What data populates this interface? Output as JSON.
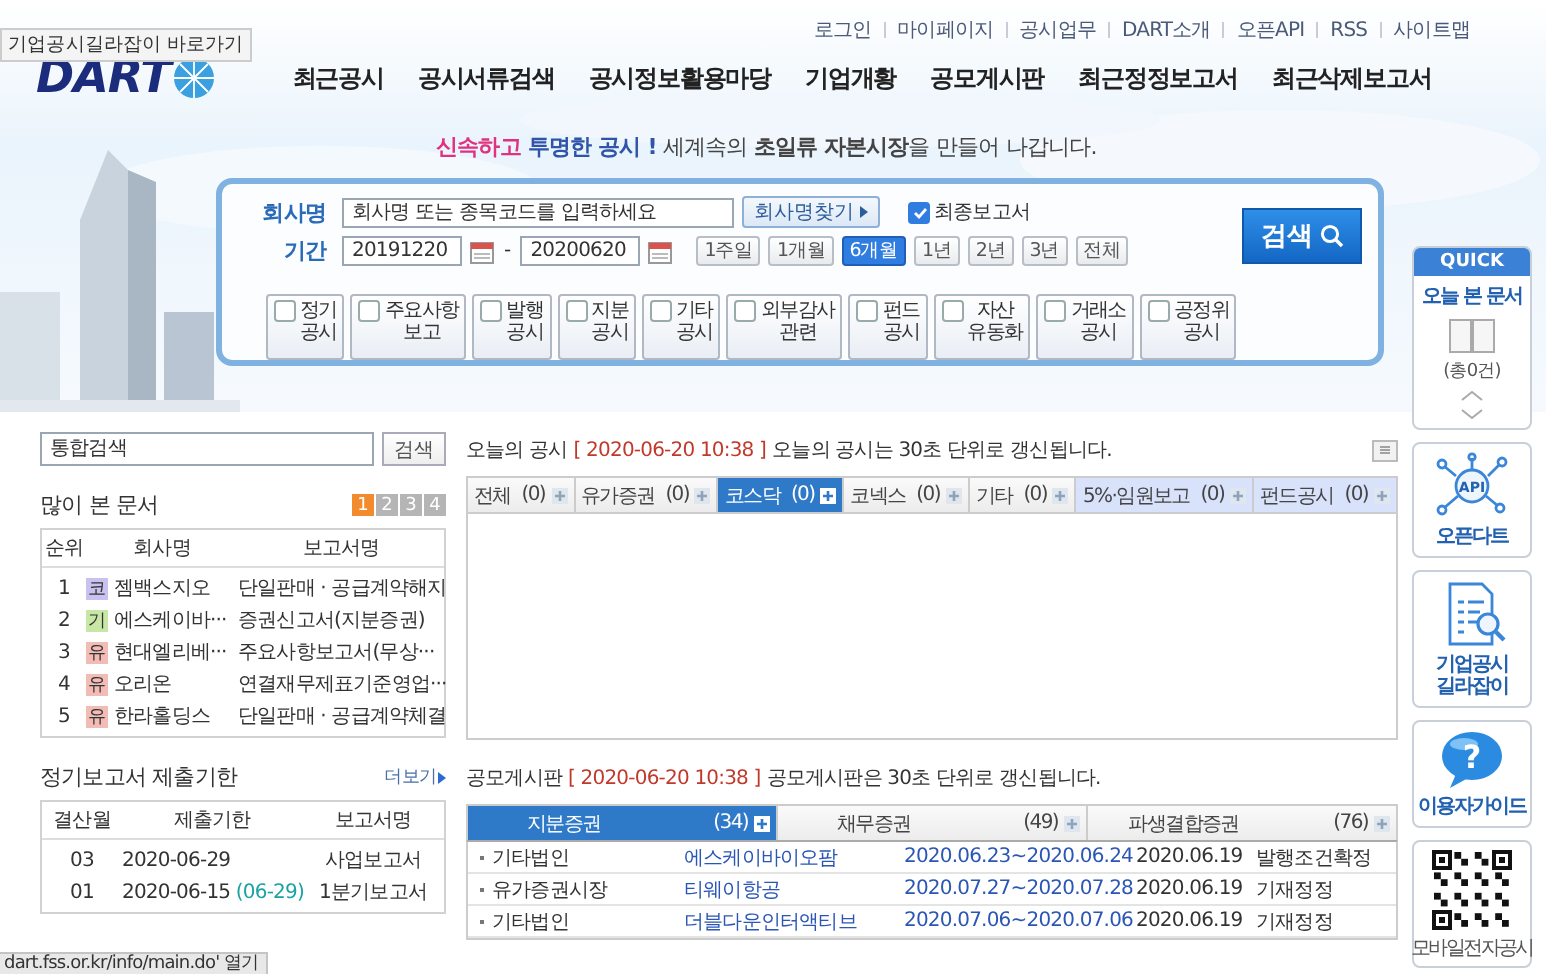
{
  "tooltip": "기업공시길라잡이 바로가기",
  "logo": "DART",
  "top_links": [
    "로그인",
    "마이페이지",
    "공시업무",
    "DART소개",
    "오픈API",
    "RSS",
    "사이트맵"
  ],
  "nav": [
    "최근공시",
    "공시서류검색",
    "공시정보활용마당",
    "기업개황",
    "공모게시판",
    "최근정정보고서",
    "최근삭제보고서"
  ],
  "slogan": [
    {
      "text": "신속하고",
      "kind": "pink"
    },
    {
      "text": " 투명한 공시 !",
      "kind": "blue"
    },
    {
      "text": " 세계속의 **초일류**  **자본시장**을 만들어 나갑니다.",
      "kind": "plain"
    }
  ],
  "search": {
    "company": {
      "label": "회사명",
      "placeholder": "회사명 또는 종목코드를 입력하세요"
    },
    "find_button": "회사명찾기",
    "final_report": {
      "label": "최종보고서",
      "checked": true
    },
    "period": {
      "label": "기간",
      "from": "20191220",
      "separator": "-",
      "to": "20200620"
    },
    "ranges": [
      {
        "label": "1주일",
        "selected": false
      },
      {
        "label": "1개월",
        "selected": false
      },
      {
        "label": "6개월",
        "selected": true
      },
      {
        "label": "1년",
        "selected": false
      },
      {
        "label": "2년",
        "selected": false
      },
      {
        "label": "3년",
        "selected": false
      },
      {
        "label": "전체",
        "selected": false
      }
    ],
    "search_button": "검색",
    "categories": [
      {
        "label": "정기 공시",
        "checked": false
      },
      {
        "label": "주요사항 보고",
        "checked": false
      },
      {
        "label": "발행 공시",
        "checked": false
      },
      {
        "label": "지분 공시",
        "checked": false
      },
      {
        "label": "기타 공시",
        "checked": false
      },
      {
        "label": "외부감사 관련",
        "checked": false
      },
      {
        "label": "펀드 공시",
        "checked": false
      },
      {
        "label": "자산 유동화",
        "checked": false
      },
      {
        "label": "거래소 공시",
        "checked": false
      },
      {
        "label": "공정위 공시",
        "checked": false
      }
    ]
  },
  "unified_search": {
    "placeholder": "통합검색",
    "button": "검색"
  },
  "popular": {
    "title": "많이 본 문서",
    "pages": [
      {
        "label": "1",
        "selected": true
      },
      {
        "label": "2",
        "selected": false
      },
      {
        "label": "3",
        "selected": false
      },
      {
        "label": "4",
        "selected": false
      }
    ],
    "columns": [
      "순위",
      "회사명",
      "보고서명"
    ],
    "rows": [
      {
        "rank": "1",
        "market": "코",
        "color": "#c9c1f0",
        "company": "젬백스지오",
        "report": "단일판매 · 공급계약해지"
      },
      {
        "rank": "2",
        "market": "기",
        "color": "#c8e6a6",
        "company": "에스케이바···",
        "report": "증권신고서(지분증권)"
      },
      {
        "rank": "3",
        "market": "유",
        "color": "#f2bcb4",
        "company": "현대엘리베···",
        "report": "주요사항보고서(무상···"
      },
      {
        "rank": "4",
        "market": "유",
        "color": "#f2bcb4",
        "company": "오리온",
        "report": "연결재무제표기준영업···"
      },
      {
        "rank": "5",
        "market": "유",
        "color": "#f2bcb4",
        "company": "한라홀딩스",
        "report": "단일판매 · 공급계약체결"
      }
    ]
  },
  "deadline": {
    "title": "정기보고서 제출기한",
    "more": "더보기",
    "columns": [
      "결산월",
      "제출기한",
      "보고서명"
    ],
    "rows": [
      {
        "month": "03",
        "deadline": "2020-06-29",
        "report": "사업보고서"
      },
      {
        "month": "01",
        "deadline": "2020-06-15",
        "extended": "(06-29)",
        "report": "1분기보고서"
      }
    ]
  },
  "today": {
    "title": "오늘의 공시",
    "timestamp": "[ 2020-06-20 10:38 ]",
    "note": "오늘의 공시는 30초 단위로 갱신됩니다.",
    "tabs": [
      {
        "label": "전체",
        "count": "(0)",
        "selected": false,
        "highlight": false
      },
      {
        "label": "유가증권",
        "count": "(0)",
        "selected": false,
        "highlight": false
      },
      {
        "label": "코스닥",
        "count": "(0)",
        "selected": true,
        "highlight": false
      },
      {
        "label": "코넥스",
        "count": "(0)",
        "selected": false,
        "highlight": false
      },
      {
        "label": "기타",
        "count": "(0)",
        "selected": false,
        "highlight": false
      },
      {
        "label": "5%·임원보고",
        "count": "(0)",
        "selected": false,
        "highlight": true
      },
      {
        "label": "펀드공시",
        "count": "(0)",
        "selected": false,
        "highlight": true
      }
    ]
  },
  "offering": {
    "title": "공모게시판",
    "timestamp": "[ 2020-06-20 10:38 ]",
    "note": "공모게시판은 30초 단위로 갱신됩니다.",
    "tabs": [
      {
        "label": "지분증권",
        "count": "(34)",
        "selected": true
      },
      {
        "label": "채무증권",
        "count": "(49)",
        "selected": false
      },
      {
        "label": "파생결합증권",
        "count": "(76)",
        "selected": false
      }
    ],
    "rows": [
      {
        "market": "기타법인",
        "company": "에스케이바이오팜",
        "period": "2020.06.23~2020.06.24",
        "date": "2020.06.19",
        "status": "발행조건확정"
      },
      {
        "market": "유가증권시장",
        "company": "티웨이항공",
        "period": "2020.07.27~2020.07.28",
        "date": "2020.06.19",
        "status": "기재정정"
      },
      {
        "market": "기타법인",
        "company": "더블다운인터액티브",
        "period": "2020.07.06~2020.07.06",
        "date": "2020.06.19",
        "status": "기재정정"
      }
    ]
  },
  "quick": {
    "header": "QUICK",
    "today_label": "오늘 본 문서",
    "count": "(총0건)",
    "cards": [
      {
        "kind": "api",
        "icon_text": "API",
        "label": "오픈다트"
      },
      {
        "kind": "guide",
        "label": "기업공시 길라잡이"
      },
      {
        "kind": "help",
        "icon_text": "?",
        "label": "이용자가이드"
      },
      {
        "kind": "qr",
        "label": "모바일전자공시"
      }
    ]
  },
  "status_bar": "dart.fss.or.kr/info/main.do' 열기"
}
